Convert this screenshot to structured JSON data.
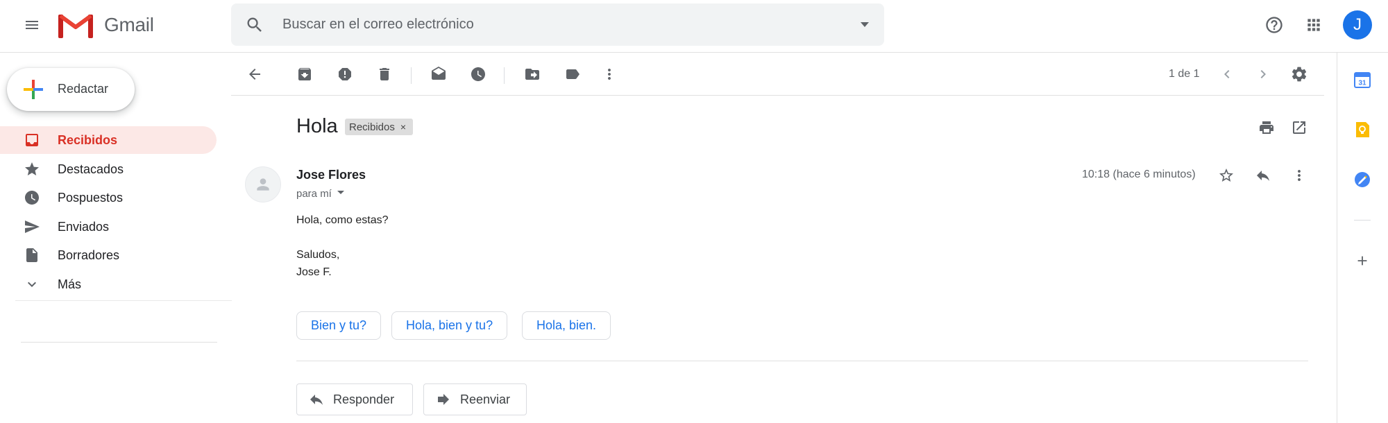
{
  "header": {
    "app_name": "Gmail",
    "search_placeholder": "Buscar en el correo electrónico",
    "avatar_letter": "J"
  },
  "sidebar": {
    "compose_label": "Redactar",
    "items": [
      {
        "label": "Recibidos",
        "icon": "inbox-icon",
        "active": true
      },
      {
        "label": "Destacados",
        "icon": "star-icon",
        "active": false
      },
      {
        "label": "Pospuestos",
        "icon": "clock-icon",
        "active": false
      },
      {
        "label": "Enviados",
        "icon": "send-icon",
        "active": false
      },
      {
        "label": "Borradores",
        "icon": "draft-icon",
        "active": false
      },
      {
        "label": "Más",
        "icon": "chevron-down-icon",
        "active": false
      }
    ]
  },
  "toolbar": {
    "page_count": "1 de 1"
  },
  "message": {
    "subject": "Hola",
    "label_chip": "Recibidos",
    "sender": "Jose Flores",
    "recipient": "para mí",
    "timestamp": "10:18 (hace 6 minutos)",
    "body_lines": [
      "Hola, como estas?",
      "",
      "Saludos,",
      "Jose F."
    ],
    "smart_replies": [
      "Bien y tu?",
      "Hola, bien y tu?",
      "Hola, bien."
    ],
    "reply_label": "Responder",
    "forward_label": "Reenviar"
  },
  "colors": {
    "accent_red": "#d93025",
    "active_bg": "#fce8e6",
    "link_blue": "#1a73e8",
    "icon_grey": "#5f6368"
  }
}
